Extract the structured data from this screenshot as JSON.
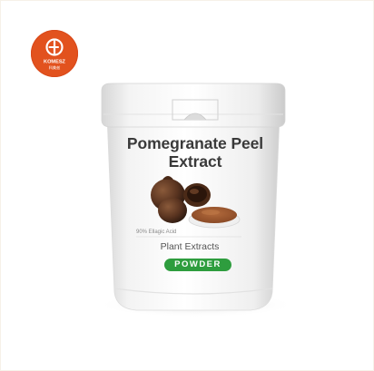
{
  "logo": {
    "brand_text": "KOMESZ",
    "sub_text": "科美兹",
    "color": "#e2521e"
  },
  "product": {
    "title": "Pomegranate Peel Extract",
    "spec": "90% Ellagic Acid",
    "category": "Plant Extracts",
    "form_badge": "POWDER",
    "badge_color": "#2e9d3e"
  }
}
